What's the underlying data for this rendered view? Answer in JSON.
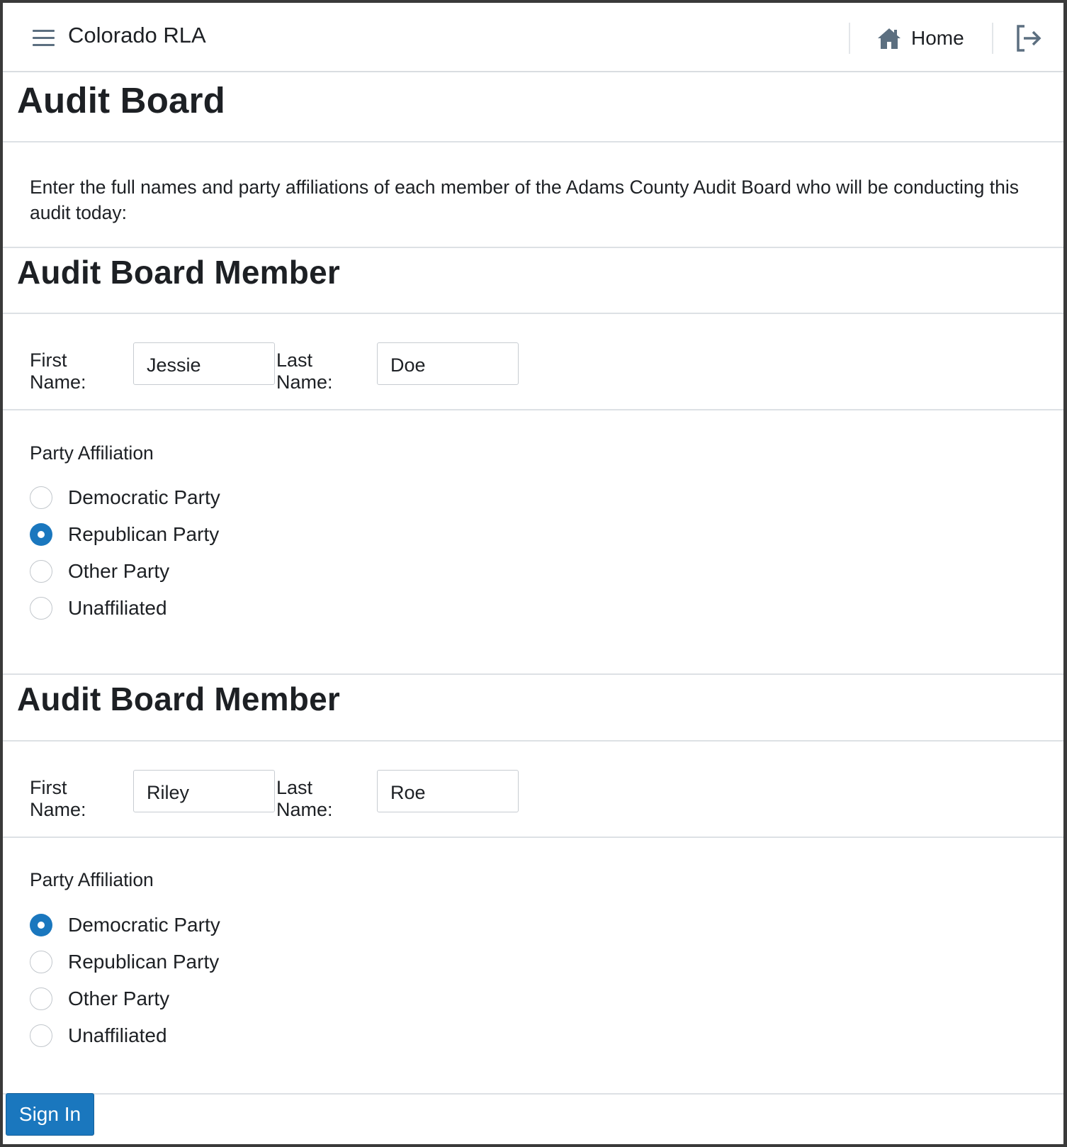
{
  "header": {
    "app_title": "Colorado RLA",
    "home_label": "Home",
    "menu_icon": "hamburger-menu-icon",
    "home_icon": "home-icon",
    "logout_icon": "logout-icon"
  },
  "page": {
    "title": "Audit Board",
    "intro": "Enter the full names and party affiliations of each member of the Adams County Audit Board who will be conducting this audit today:"
  },
  "members": [
    {
      "heading": "Audit Board Member",
      "first_name_label": "First Name:",
      "first_name_value": "Jessie",
      "last_name_label": "Last Name:",
      "last_name_value": "Doe",
      "party_label": "Party Affiliation",
      "parties": [
        {
          "label": "Democratic Party",
          "checked": false
        },
        {
          "label": "Republican Party",
          "checked": true
        },
        {
          "label": "Other Party",
          "checked": false
        },
        {
          "label": "Unaffiliated",
          "checked": false
        }
      ]
    },
    {
      "heading": "Audit Board Member",
      "first_name_label": "First Name:",
      "first_name_value": "Riley",
      "last_name_label": "Last Name:",
      "last_name_value": "Roe",
      "party_label": "Party Affiliation",
      "parties": [
        {
          "label": "Democratic Party",
          "checked": true
        },
        {
          "label": "Republican Party",
          "checked": false
        },
        {
          "label": "Other Party",
          "checked": false
        },
        {
          "label": "Unaffiliated",
          "checked": false
        }
      ]
    }
  ],
  "actions": {
    "sign_in_label": "Sign In"
  },
  "colors": {
    "primary": "#1a77be",
    "text": "#1d2024",
    "divider": "#dde1e5",
    "icon": "#5c6f80"
  }
}
